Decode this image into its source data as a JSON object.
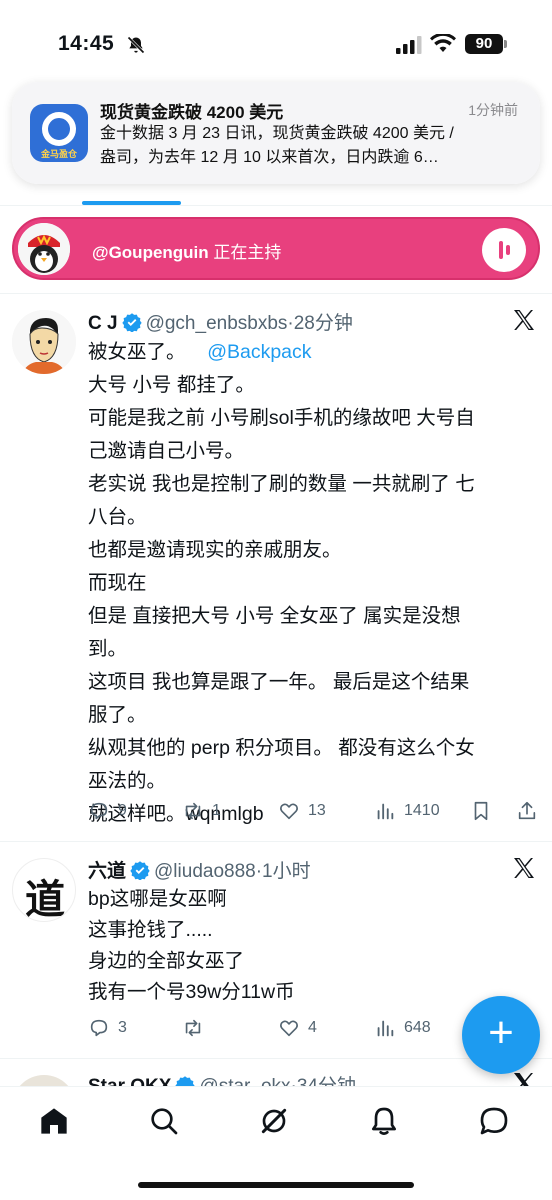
{
  "status_bar": {
    "time": "14:45",
    "battery": "90",
    "icons": [
      "bell-slash-icon",
      "cellular-signal-icon",
      "wifi-icon",
      "battery-icon"
    ]
  },
  "notification": {
    "app_icon": "jinshi-app-icon",
    "app_icon_text": "金马盈仓",
    "title": "现货黄金跌破 4200 美元",
    "time": "1分钟前",
    "body_line1": "金十数据 3 月 23 日讯，现货黄金跌破 4200 美元 /",
    "body_line2": "盎司，为去年 12 月 10 以来首次，日内跌逾 6…"
  },
  "spaces_bar": {
    "host": "@Goupenguin",
    "status": "正在主持",
    "accent": "#e8407e"
  },
  "tweets": [
    {
      "name": "C J",
      "handle": "@gch_enbsbxbs",
      "time": "·28分钟",
      "lines": {
        "l1_a": "被女巫了。",
        "l1_mention": "@Backpack",
        "l2": "大号 小号 都挂了。",
        "l3": "可能是我之前 小号刷sol手机的缘故吧 大号自",
        "l4": "己邀请自己小号。",
        "l5": "老实说 我也是控制了刷的数量 一共就刷了 七",
        "l6": "八台。",
        "l7": "也都是邀请现实的亲戚朋友。",
        "l8": "而现在",
        "l9": "但是 直接把大号 小号 全女巫了 属实是没想",
        "l10": "到。",
        "l11": "这项目 我也算是跟了一年。 最后是这个结果",
        "l12": "服了。",
        "l13": "纵观其他的 perp 积分项目。 都没有这么个女",
        "l14": "巫法的。",
        "l15": "就这样吧。wqnmlgb"
      },
      "replies": "9",
      "retweets": "1",
      "likes": "13",
      "views": "1410"
    },
    {
      "name": "六道",
      "handle": "@liudao888",
      "time": "·1小时",
      "avatar_char": "道",
      "lines": {
        "l1": "bp这哪是女巫啊",
        "l2": "这事抢钱了.....",
        "l3": "身边的全部女巫了",
        "l4": "我有一个号39w分11w币"
      },
      "replies": "3",
      "retweets": "",
      "likes": "4",
      "views": "648"
    },
    {
      "name": "Star OKX",
      "handle": "@star_okx",
      "time": "·34分钟"
    }
  ],
  "fab": {
    "label": "+"
  },
  "bottom_nav": [
    "home-icon",
    "search-icon",
    "grok-icon",
    "notifications-icon",
    "messages-icon"
  ],
  "colors": {
    "accent_blue": "#1d9bf0",
    "secondary_text": "#536471",
    "primary_text": "#0f1419"
  }
}
